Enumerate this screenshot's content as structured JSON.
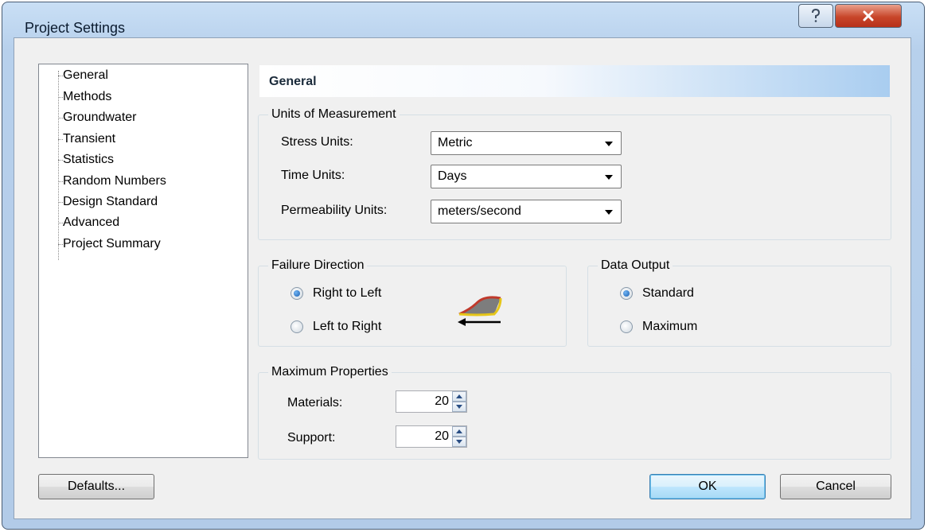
{
  "window": {
    "title": "Project Settings",
    "help_icon": "question-mark-icon",
    "close_icon": "close-x-icon"
  },
  "tree": {
    "items": [
      "General",
      "Methods",
      "Groundwater",
      "Transient",
      "Statistics",
      "Random Numbers",
      "Design Standard",
      "Advanced",
      "Project Summary"
    ],
    "selected": "General"
  },
  "panel": {
    "header": "General"
  },
  "units": {
    "group_title": "Units of Measurement",
    "stress_label": "Stress Units:",
    "stress_value": "Metric",
    "time_label": "Time Units:",
    "time_value": "Days",
    "perm_label": "Permeability Units:",
    "perm_value": "meters/second"
  },
  "failure": {
    "group_title": "Failure Direction",
    "option1": "Right to Left",
    "option2": "Left to Right",
    "selected": "Right to Left",
    "icon": "slope-failure-direction-icon"
  },
  "output": {
    "group_title": "Data Output",
    "option1": "Standard",
    "option2": "Maximum",
    "selected": "Standard"
  },
  "maxprops": {
    "group_title": "Maximum Properties",
    "materials_label": "Materials:",
    "materials_value": "20",
    "support_label": "Support:",
    "support_value": "20"
  },
  "buttons": {
    "defaults": "Defaults...",
    "ok": "OK",
    "cancel": "Cancel"
  },
  "colors": {
    "title_bar": "#b7d0ec",
    "close_button": "#c8462a",
    "header_gradient_end": "#a9cdf0",
    "dialog_bg": "#f0f0f0"
  }
}
